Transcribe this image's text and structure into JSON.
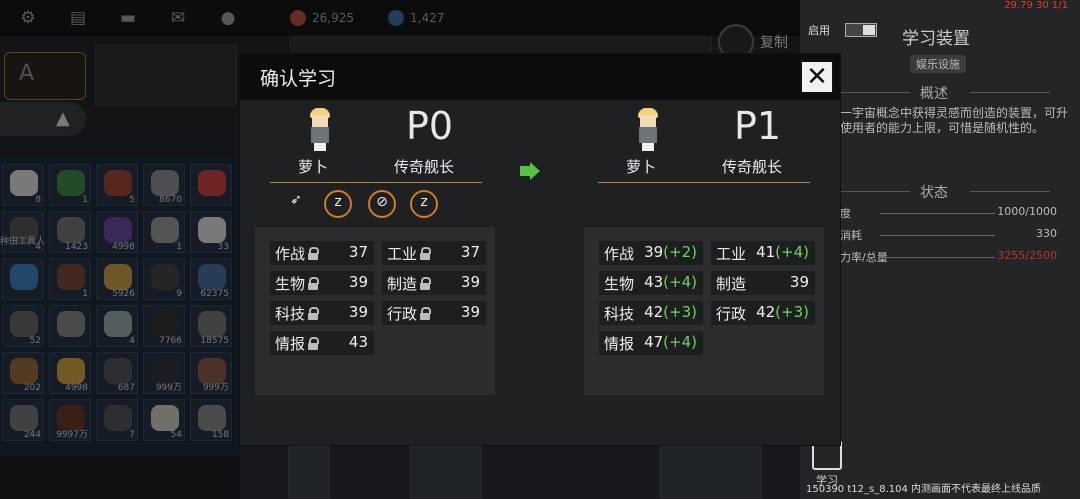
{
  "topbar": {
    "icons": [
      "gear-icon",
      "chat-icon",
      "message-icon",
      "mail-icon",
      "person-icon"
    ],
    "resource1": "26,925",
    "resource2": "1,427",
    "copy_label": "复制"
  },
  "inventory": {
    "counts": [
      "8",
      "1",
      "5",
      "8670",
      "",
      "4",
      "1423",
      "4998",
      "1",
      "33",
      "",
      "1",
      "5926",
      "9",
      "62375",
      "52",
      "",
      "4",
      "7766",
      "18575",
      "202",
      "4998",
      "687",
      "999万",
      "999万",
      "244",
      "9997万",
      "7",
      "54",
      "158"
    ],
    "worker_label": "种田工具人"
  },
  "modal": {
    "title": "确认学习",
    "close": "✕",
    "before": {
      "name": "萝卜",
      "level": "P0",
      "rank": "传奇舰长",
      "stats": [
        {
          "label": "作战",
          "value": "37",
          "plus": ""
        },
        {
          "label": "工业",
          "value": "37",
          "plus": ""
        },
        {
          "label": "生物",
          "value": "39",
          "plus": ""
        },
        {
          "label": "制造",
          "value": "39",
          "plus": ""
        },
        {
          "label": "科技",
          "value": "39",
          "plus": ""
        },
        {
          "label": "行政",
          "value": "39",
          "plus": ""
        },
        {
          "label": "情报",
          "value": "43",
          "plus": ""
        }
      ]
    },
    "after": {
      "name": "萝卜",
      "level": "P1",
      "rank": "传奇舰长",
      "stats": [
        {
          "label": "作战",
          "value": "39",
          "plus": "(+2)"
        },
        {
          "label": "工业",
          "value": "41",
          "plus": "(+4)"
        },
        {
          "label": "生物",
          "value": "43",
          "plus": "(+4)"
        },
        {
          "label": "制造",
          "value": "39",
          "plus": ""
        },
        {
          "label": "科技",
          "value": "42",
          "plus": "(+3)"
        },
        {
          "label": "行政",
          "value": "42",
          "plus": "(+3)"
        },
        {
          "label": "情报",
          "value": "47",
          "plus": "(+4)"
        }
      ]
    },
    "trait_icons": [
      "rocket-trait-icon",
      "sleep-trait-icon",
      "anti-rocket-trait-icon",
      "sleep-trait-icon"
    ]
  },
  "side": {
    "debug": "29.79 30 1/1",
    "enable_label": "启用",
    "title": "学习装置",
    "tag": "娱乐设施",
    "overview_head": "概述",
    "description": "一宇宙概念中获得灵感而创造的装置，可升使用者的能力上限，可惜是随机性的。",
    "status_head": "状态",
    "rows": [
      {
        "label": "度",
        "value": "1000/1000",
        "color": "#bbbbbb"
      },
      {
        "label": "消耗",
        "value": "330",
        "color": "#bbbbbb"
      },
      {
        "label": "力率/总量",
        "value": "3255/2500",
        "color": "#b8342c"
      }
    ],
    "learn_label": "学习",
    "version": "150390 t12_s_8.104  内测画面不代表最终上线品质"
  }
}
